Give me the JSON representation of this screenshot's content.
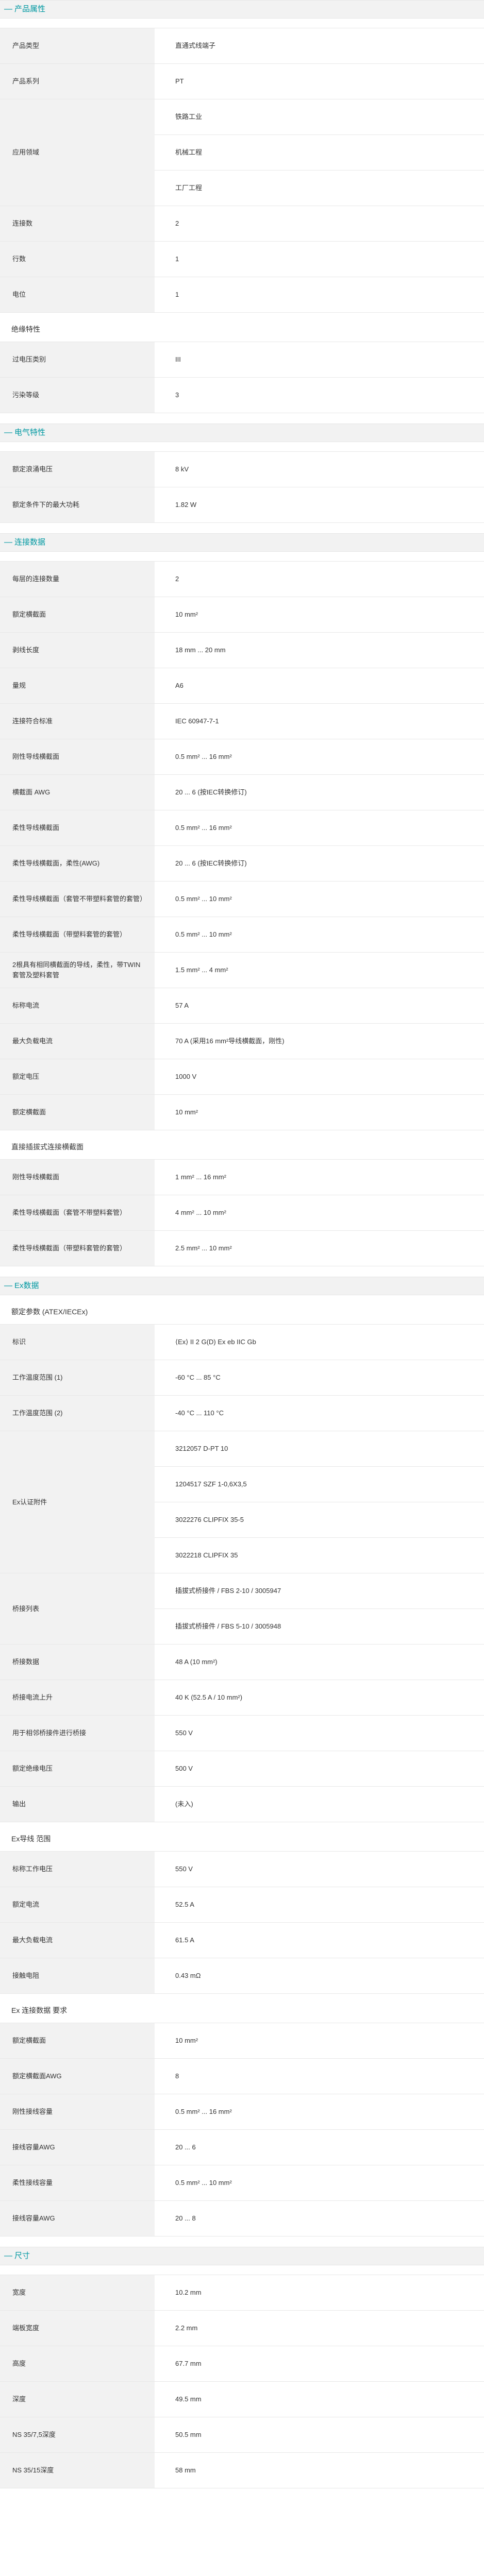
{
  "sections": [
    {
      "title": "产品属性",
      "groups": [
        {
          "subtitle": "",
          "rows": [
            {
              "label": "产品类型",
              "values": [
                "直通式线端子"
              ]
            },
            {
              "label": "产品系列",
              "values": [
                "PT"
              ]
            },
            {
              "label": "应用领域",
              "values": [
                "铁路工业",
                "机械工程",
                "工厂工程"
              ]
            },
            {
              "label": "连接数",
              "values": [
                "2"
              ]
            },
            {
              "label": "行数",
              "values": [
                "1"
              ]
            },
            {
              "label": "电位",
              "values": [
                "1"
              ]
            }
          ]
        },
        {
          "subtitle": "绝缘特性",
          "rows": [
            {
              "label": "过电压类别",
              "values": [
                "III"
              ]
            },
            {
              "label": "污染等级",
              "values": [
                "3"
              ]
            }
          ]
        }
      ]
    },
    {
      "title": "电气特性",
      "groups": [
        {
          "subtitle": "",
          "rows": [
            {
              "label": "额定浪涌电压",
              "values": [
                "8 kV"
              ]
            },
            {
              "label": "额定条件下的最大功耗",
              "values": [
                "1.82 W"
              ]
            }
          ]
        }
      ]
    },
    {
      "title": "连接数据",
      "groups": [
        {
          "subtitle": "",
          "rows": [
            {
              "label": "每层的连接数量",
              "values": [
                "2"
              ]
            },
            {
              "label": "额定横截面",
              "values": [
                "10 mm²"
              ]
            },
            {
              "label": "剥线长度",
              "values": [
                "18 mm ... 20 mm"
              ]
            },
            {
              "label": "量规",
              "values": [
                "A6"
              ]
            },
            {
              "label": "连接符合标准",
              "values": [
                "IEC 60947-7-1"
              ]
            },
            {
              "label": "刚性导线横截面",
              "values": [
                "0.5 mm² ... 16 mm²"
              ]
            },
            {
              "label": "横截面 AWG",
              "values": [
                "20 ... 6 (按IEC转换修订)"
              ]
            },
            {
              "label": "柔性导线横截面",
              "values": [
                "0.5 mm² ... 16 mm²"
              ]
            },
            {
              "label": "柔性导线横截面，柔性(AWG)",
              "values": [
                "20 ... 6 (按IEC转换修订)"
              ]
            },
            {
              "label": "柔性导线横截面（套管不带塑料套管的套管）",
              "values": [
                "0.5 mm² ... 10 mm²"
              ]
            },
            {
              "label": "柔性导线横截面（带塑料套管的套管）",
              "values": [
                "0.5 mm² ... 10 mm²"
              ]
            },
            {
              "label": "2根具有相同横截面的导线，柔性，带TWIN套管及塑料套管",
              "values": [
                "1.5 mm² ... 4 mm²"
              ]
            },
            {
              "label": "标称电流",
              "values": [
                "57 A"
              ]
            },
            {
              "label": "最大负载电流",
              "values": [
                "70 A (采用16 mm²导线横截面，刚性)"
              ]
            },
            {
              "label": "额定电压",
              "values": [
                "1000 V"
              ]
            },
            {
              "label": "额定横截面",
              "values": [
                "10 mm²"
              ]
            }
          ]
        },
        {
          "subtitle": "直接插拔式连接横截面",
          "rows": [
            {
              "label": "刚性导线横截面",
              "values": [
                "1 mm² ... 16 mm²"
              ]
            },
            {
              "label": "柔性导线横截面（套管不带塑料套管）",
              "values": [
                "4 mm² ... 10 mm²"
              ]
            },
            {
              "label": "柔性导线横截面（带塑料套管的套管）",
              "values": [
                "2.5 mm² ... 10 mm²"
              ]
            }
          ]
        }
      ]
    },
    {
      "title": "Ex数据",
      "groups": [
        {
          "subtitle": "额定参数 (ATEX/IECEx)",
          "rows": [
            {
              "label": "标识",
              "values": [
                "⟨Ex⟩ II 2 G(D) Ex eb IIC Gb"
              ]
            },
            {
              "label": "工作温度范围 (1)",
              "values": [
                "-60 °C ... 85 °C"
              ]
            },
            {
              "label": "工作温度范围 (2)",
              "values": [
                "-40 °C ... 110 °C"
              ]
            },
            {
              "label": "Ex认证附件",
              "values": [
                "3212057 D-PT 10",
                "1204517 SZF 1-0,6X3,5",
                "3022276 CLIPFIX 35-5",
                "3022218 CLIPFIX 35"
              ]
            },
            {
              "label": "桥接列表",
              "values": [
                "插拔式桥接件 / FBS 2-10 / 3005947",
                "插拔式桥接件 / FBS 5-10 / 3005948"
              ]
            },
            {
              "label": "桥接数据",
              "values": [
                "48 A (10 mm²)"
              ]
            },
            {
              "label": "桥接电流上升",
              "values": [
                "40 K (52.5 A / 10 mm²)"
              ]
            },
            {
              "label": "用于相邻桥接件进行桥接",
              "values": [
                "550 V"
              ]
            },
            {
              "label": "额定绝缘电压",
              "values": [
                "500 V"
              ]
            },
            {
              "label": "输出",
              "values": [
                "(未入)"
              ]
            }
          ]
        },
        {
          "subtitle": "Ex导线 范围",
          "rows": [
            {
              "label": "标称工作电压",
              "values": [
                "550 V"
              ]
            },
            {
              "label": "额定电流",
              "values": [
                "52.5 A"
              ]
            },
            {
              "label": "最大负载电流",
              "values": [
                "61.5 A"
              ]
            },
            {
              "label": "接触电阻",
              "values": [
                "0.43 mΩ"
              ]
            }
          ]
        },
        {
          "subtitle": "Ex 连接数据 要求",
          "rows": [
            {
              "label": "额定横截面",
              "values": [
                "10 mm²"
              ]
            },
            {
              "label": "额定横截面AWG",
              "values": [
                "8"
              ]
            },
            {
              "label": "刚性接线容量",
              "values": [
                "0.5 mm² ... 16 mm²"
              ]
            },
            {
              "label": "接线容量AWG",
              "values": [
                "20 ... 6"
              ]
            },
            {
              "label": "柔性接线容量",
              "values": [
                "0.5 mm² ... 10 mm²"
              ]
            },
            {
              "label": "接线容量AWG",
              "values": [
                "20 ... 8"
              ]
            }
          ]
        }
      ]
    },
    {
      "title": "尺寸",
      "groups": [
        {
          "subtitle": "",
          "rows": [
            {
              "label": "宽度",
              "values": [
                "10.2 mm"
              ]
            },
            {
              "label": "端板宽度",
              "values": [
                "2.2 mm"
              ]
            },
            {
              "label": "高度",
              "values": [
                "67.7 mm"
              ]
            },
            {
              "label": "深度",
              "values": [
                "49.5 mm"
              ]
            },
            {
              "label": "NS 35/7,5深度",
              "values": [
                "50.5 mm"
              ]
            },
            {
              "label": "NS 35/15深度",
              "values": [
                "58 mm"
              ]
            }
          ]
        }
      ]
    }
  ]
}
